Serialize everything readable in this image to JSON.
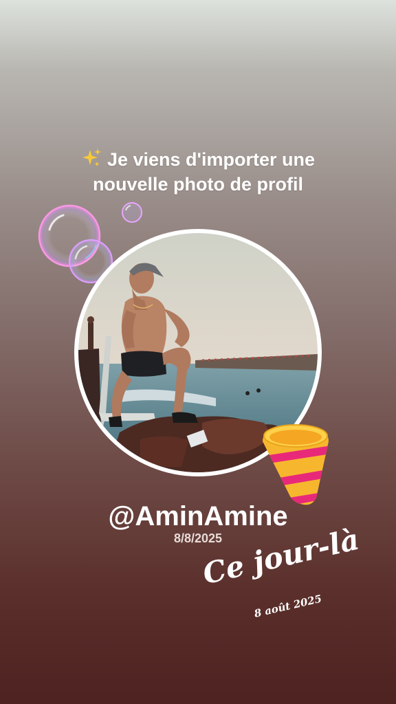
{
  "story": {
    "headline_line1": "Je viens d'importer une",
    "headline_line2": "nouvelle photo de profil",
    "sparkle_icon": "sparkles-emoji",
    "handle": "@AminAmine",
    "date": "8/8/2025",
    "memory_title": "Ce jour-là",
    "memory_date": "8 août 2025",
    "decorations": [
      "soap-bubbles",
      "party-horn"
    ]
  },
  "colors": {
    "background_top": "#dde2dd",
    "background_bottom": "#4d2220",
    "text": "#ffffff",
    "frame": "#ffffff",
    "horn_yellow": "#f6b72e",
    "horn_pink": "#e8297a"
  }
}
